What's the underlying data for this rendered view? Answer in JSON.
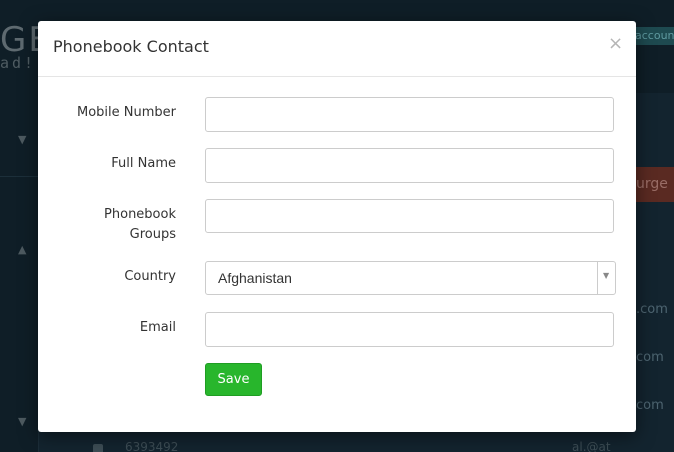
{
  "background": {
    "logo_main": "GE",
    "logo_sub": "ad!",
    "account_badge": "accoun",
    "purge_button": "urge",
    "rows": [
      ".com",
      "com",
      "com"
    ],
    "bottom_left_text": "6393492",
    "bottom_right_text": "al.@at"
  },
  "modal": {
    "title": "Phonebook Contact",
    "close_symbol": "×",
    "fields": {
      "mobile_number": {
        "label": "Mobile Number",
        "value": ""
      },
      "full_name": {
        "label": "Full Name",
        "value": ""
      },
      "phonebook_groups": {
        "label_line1": "Phonebook",
        "label_line2": "Groups",
        "value": ""
      },
      "country": {
        "label": "Country",
        "value": "Afghanistan",
        "arrow": "▼"
      },
      "email": {
        "label": "Email",
        "value": ""
      }
    },
    "save_label": "Save"
  },
  "colors": {
    "save_green": "#28b62c",
    "overlay": "#13242f"
  }
}
